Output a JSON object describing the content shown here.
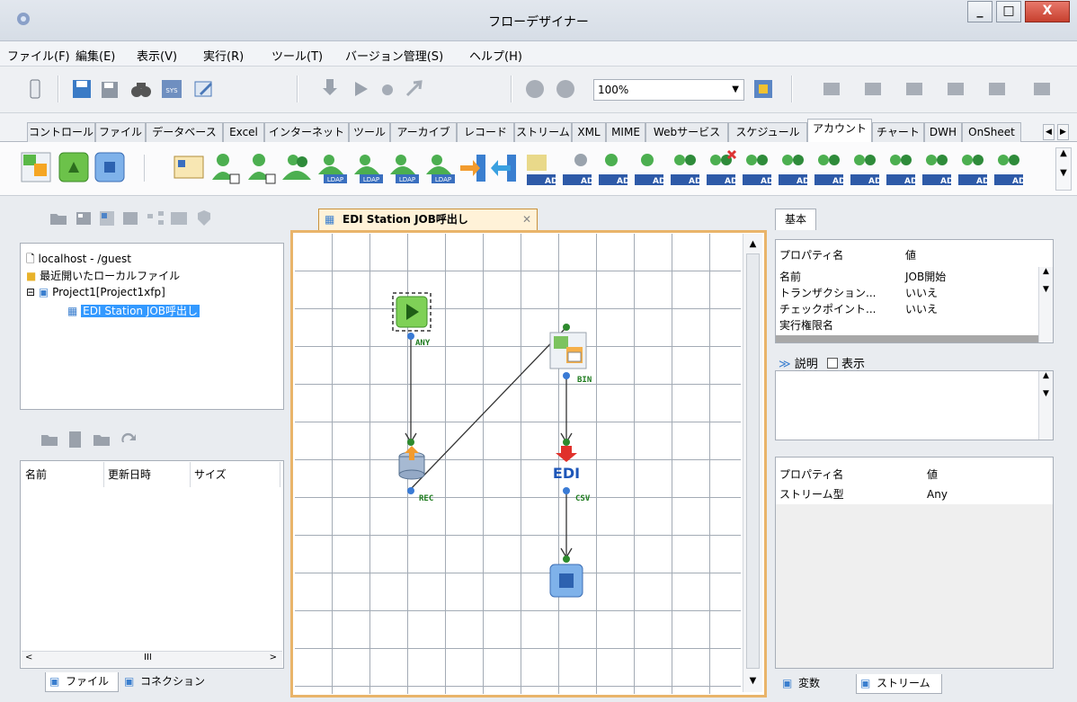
{
  "window": {
    "title": "フローデザイナー"
  },
  "menu": [
    "ファイル(F)",
    "編集(E)",
    "表示(V)",
    "実行(R)",
    "ツール(T)",
    "バージョン管理(S)",
    "ヘルプ(H)"
  ],
  "toolbar": {
    "zoom_value": "100%"
  },
  "palette_tabs": [
    "コントロール",
    "ファイル",
    "データベース",
    "Excel",
    "インターネット",
    "ツール",
    "アーカイブ",
    "レコード",
    "ストリーム",
    "XML",
    "MIME",
    "Webサービス",
    "スケジュール",
    "アカウント",
    "チャート",
    "DWH",
    "OnSheet"
  ],
  "palette_active_tab": "アカウント",
  "palette_icon_labels": {
    "ldap": "LDAP",
    "ad": "AD"
  },
  "tree": {
    "server": "localhost - /guest",
    "recent": "最近開いたローカルファイル",
    "project": "Project1[Project1xfp]",
    "flow": "EDI Station JOB呼出し"
  },
  "file_list": {
    "columns": [
      "名前",
      "更新日時",
      "サイズ"
    ]
  },
  "left_bottom_tabs": [
    "ファイル",
    "コネクション"
  ],
  "editor": {
    "tab_title": "EDI Station JOB呼出し"
  },
  "canvas": {
    "nodes": [
      {
        "name": "start",
        "port": "ANY"
      },
      {
        "name": "db-read",
        "port": "REC"
      },
      {
        "name": "mapper",
        "port": "BIN"
      },
      {
        "name": "edi",
        "port": "CSV",
        "label": "EDI"
      },
      {
        "name": "end"
      }
    ]
  },
  "props": {
    "tab": "基本",
    "header_name": "プロパティ名",
    "header_value": "値",
    "rows": [
      {
        "k": "名前",
        "v": "JOB開始"
      },
      {
        "k": "トランザクション...",
        "v": "いいえ"
      },
      {
        "k": "チェックポイント...",
        "v": "いいえ"
      },
      {
        "k": "実行権限名",
        "v": ""
      }
    ],
    "desc_label": "説明",
    "desc_checkbox": "表示"
  },
  "stream_props": {
    "header_name": "プロパティ名",
    "header_value": "値",
    "rows": [
      {
        "k": "ストリーム型",
        "v": "Any"
      }
    ]
  },
  "right_bottom_tabs": [
    "変数",
    "ストリーム"
  ]
}
